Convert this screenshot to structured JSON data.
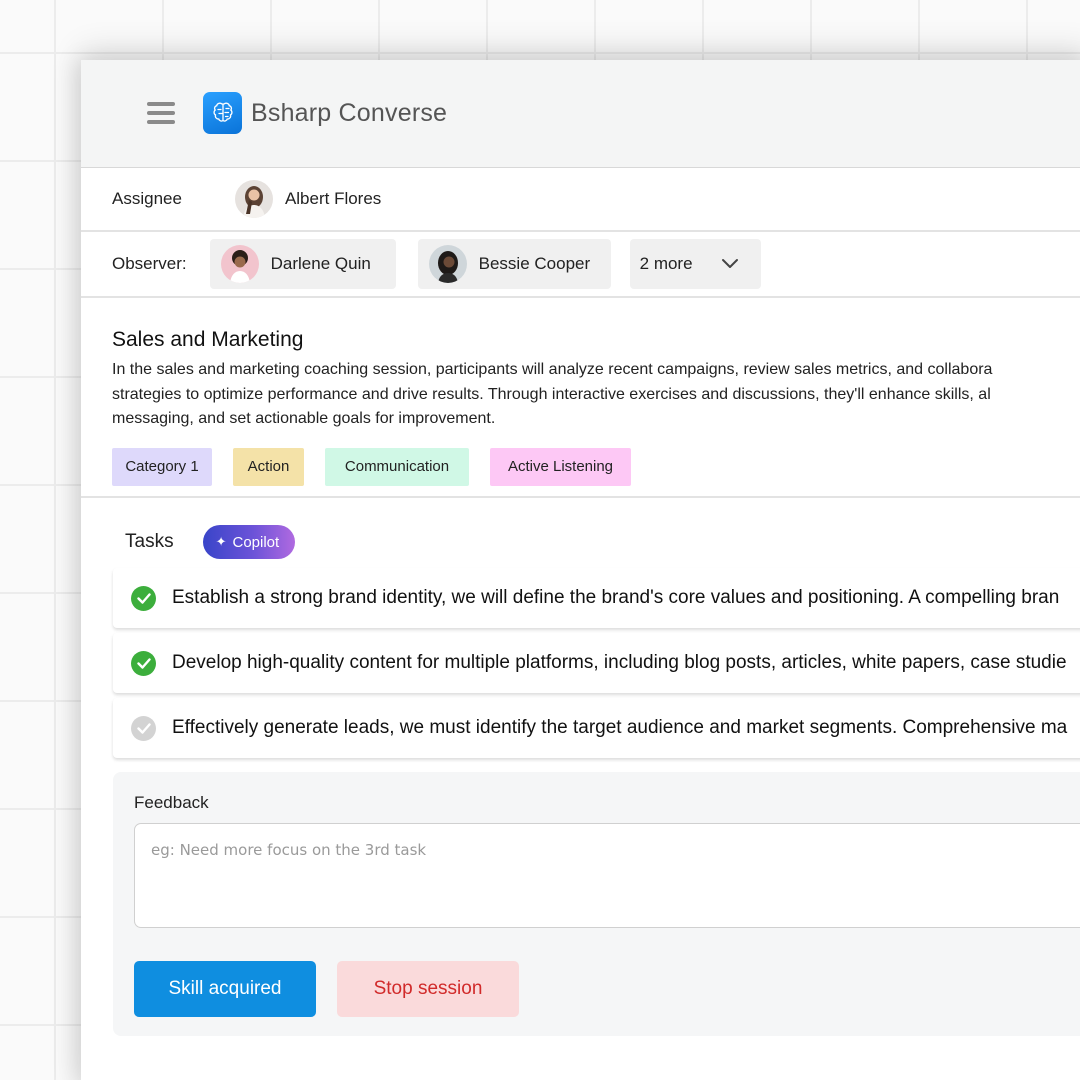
{
  "app": {
    "title": "Bsharp Converse",
    "menu_icon": "hamburger-icon",
    "logo_icon": "brain-icon",
    "accent_color": "#0f8ee0"
  },
  "assignee": {
    "label": "Assignee",
    "name": "Albert Flores"
  },
  "observers": {
    "label": "Observer:",
    "people": [
      {
        "name": "Darlene Quin"
      },
      {
        "name": "Bessie Cooper"
      }
    ],
    "more_label": "2 more",
    "more_icon": "chevron-down-icon"
  },
  "session": {
    "title": "Sales and Marketing",
    "description_lines": [
      "In the sales and marketing coaching session, participants will analyze recent campaigns, review sales metrics, and collabora",
      "strategies to optimize performance and drive results. Through interactive exercises and discussions, they'll enhance skills, al",
      "messaging, and set actionable goals for improvement."
    ],
    "tags": [
      {
        "label": "Category 1",
        "color": "#ded9fb"
      },
      {
        "label": "Action",
        "color": "#f4e2a8"
      },
      {
        "label": "Communication",
        "color": "#d0f8e6"
      },
      {
        "label": "Active Listening",
        "color": "#fdc8f5"
      }
    ]
  },
  "tasks": {
    "label": "Tasks",
    "copilot_label": "Copilot",
    "items": [
      {
        "text": "Establish a strong brand identity, we will define the brand's core values and positioning. A compelling bran",
        "status": "done"
      },
      {
        "text": "Develop high-quality content for multiple platforms, including blog posts, articles, white papers, case studie",
        "status": "done"
      },
      {
        "text": "Effectively generate leads, we must identify the target audience and market segments. Comprehensive ma",
        "status": "pending"
      }
    ]
  },
  "feedback": {
    "label": "Feedback",
    "value": "",
    "placeholder": "eg: Need more focus on the 3rd task",
    "primary_button": "Skill acquired",
    "secondary_button": "Stop session"
  }
}
